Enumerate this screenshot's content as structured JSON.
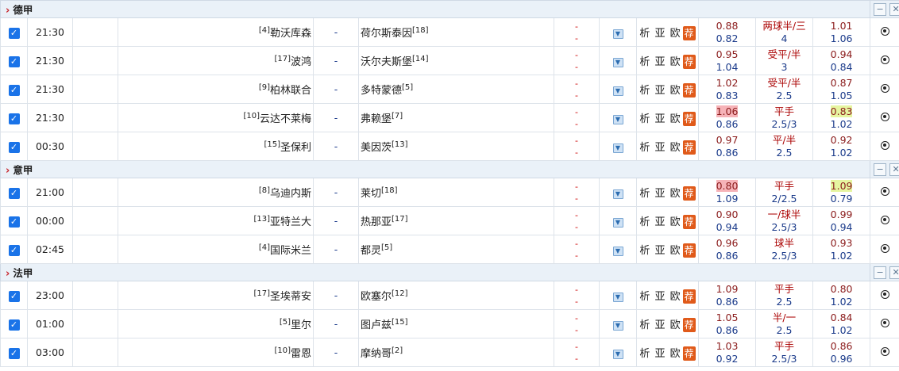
{
  "leagues": [
    {
      "name": "德甲",
      "matches": [
        {
          "time": "21:30",
          "home_rank": "[4]",
          "home": "勒沃库森",
          "vs": "-",
          "away": "荷尔斯泰因",
          "away_rank": "[18]",
          "score_top": "-",
          "score_bot": "-",
          "links": "析 亚 欧",
          "tip": "荐",
          "o1a": "0.88",
          "o1b": "0.82",
          "h1": "两球半/三",
          "h2": "4",
          "o2a": "1.01",
          "o2b": "1.06",
          "hl1": "",
          "hl2": ""
        },
        {
          "time": "21:30",
          "home_rank": "[17]",
          "home": "波鸿",
          "vs": "-",
          "away": "沃尔夫斯堡",
          "away_rank": "[14]",
          "score_top": "-",
          "score_bot": "-",
          "links": "析 亚 欧",
          "tip": "荐",
          "o1a": "0.95",
          "o1b": "1.04",
          "h1": "受平/半",
          "h2": "3",
          "o2a": "0.94",
          "o2b": "0.84",
          "hl1": "",
          "hl2": ""
        },
        {
          "time": "21:30",
          "home_rank": "[9]",
          "home": "柏林联合",
          "vs": "-",
          "away": "多特蒙德",
          "away_rank": "[5]",
          "score_top": "-",
          "score_bot": "-",
          "links": "析 亚 欧",
          "tip": "荐",
          "o1a": "1.02",
          "o1b": "0.83",
          "h1": "受平/半",
          "h2": "2.5",
          "o2a": "0.87",
          "o2b": "1.05",
          "hl1": "",
          "hl2": ""
        },
        {
          "time": "21:30",
          "home_rank": "[10]",
          "home": "云达不莱梅",
          "vs": "-",
          "away": "弗赖堡",
          "away_rank": "[7]",
          "score_top": "-",
          "score_bot": "-",
          "links": "析 亚 欧",
          "tip": "荐",
          "o1a": "1.06",
          "o1b": "0.86",
          "h1": "平手",
          "h2": "2.5/3",
          "o2a": "0.83",
          "o2b": "1.02",
          "hl1": "pk",
          "hl2": "yl"
        },
        {
          "time": "00:30",
          "home_rank": "[15]",
          "home": "圣保利",
          "vs": "-",
          "away": "美因茨",
          "away_rank": "[13]",
          "score_top": "-",
          "score_bot": "-",
          "links": "析 亚 欧",
          "tip": "荐",
          "o1a": "0.97",
          "o1b": "0.86",
          "h1": "平/半",
          "h2": "2.5",
          "o2a": "0.92",
          "o2b": "1.02",
          "hl1": "",
          "hl2": ""
        }
      ]
    },
    {
      "name": "意甲",
      "matches": [
        {
          "time": "21:00",
          "home_rank": "[8]",
          "home": "乌迪内斯",
          "vs": "-",
          "away": "莱切",
          "away_rank": "[18]",
          "score_top": "-",
          "score_bot": "-",
          "links": "析 亚 欧",
          "tip": "荐",
          "o1a": "0.80",
          "o1b": "1.09",
          "h1": "平手",
          "h2": "2/2.5",
          "o2a": "1.09",
          "o2b": "0.79",
          "hl1": "pk",
          "hl2": "yl"
        },
        {
          "time": "00:00",
          "home_rank": "[13]",
          "home": "亚特兰大",
          "vs": "-",
          "away": "热那亚",
          "away_rank": "[17]",
          "score_top": "-",
          "score_bot": "-",
          "links": "析 亚 欧",
          "tip": "荐",
          "o1a": "0.90",
          "o1b": "0.94",
          "h1": "一/球半",
          "h2": "2.5/3",
          "o2a": "0.99",
          "o2b": "0.94",
          "hl1": "",
          "hl2": ""
        },
        {
          "time": "02:45",
          "home_rank": "[4]",
          "home": "国际米兰",
          "vs": "-",
          "away": "都灵",
          "away_rank": "[5]",
          "score_top": "-",
          "score_bot": "-",
          "links": "析 亚 欧",
          "tip": "荐",
          "o1a": "0.96",
          "o1b": "0.86",
          "h1": "球半",
          "h2": "2.5/3",
          "o2a": "0.93",
          "o2b": "1.02",
          "hl1": "",
          "hl2": ""
        }
      ]
    },
    {
      "name": "法甲",
      "matches": [
        {
          "time": "23:00",
          "home_rank": "[17]",
          "home": "圣埃蒂安",
          "vs": "-",
          "away": "欧塞尔",
          "away_rank": "[12]",
          "score_top": "-",
          "score_bot": "-",
          "links": "析 亚 欧",
          "tip": "荐",
          "o1a": "1.09",
          "o1b": "0.86",
          "h1": "平手",
          "h2": "2.5",
          "o2a": "0.80",
          "o2b": "1.02",
          "hl1": "",
          "hl2": ""
        },
        {
          "time": "01:00",
          "home_rank": "[5]",
          "home": "里尔",
          "vs": "-",
          "away": "图卢兹",
          "away_rank": "[15]",
          "score_top": "-",
          "score_bot": "-",
          "links": "析 亚 欧",
          "tip": "荐",
          "o1a": "1.05",
          "o1b": "0.86",
          "h1": "半/一",
          "h2": "2.5",
          "o2a": "0.84",
          "o2b": "1.02",
          "hl1": "",
          "hl2": ""
        },
        {
          "time": "03:00",
          "home_rank": "[10]",
          "home": "雷恩",
          "vs": "-",
          "away": "摩纳哥",
          "away_rank": "[2]",
          "score_top": "-",
          "score_bot": "-",
          "links": "析 亚 欧",
          "tip": "荐",
          "o1a": "1.03",
          "o1b": "0.92",
          "h1": "平手",
          "h2": "2.5/3",
          "o2a": "0.86",
          "o2b": "0.96",
          "hl1": "",
          "hl2": ""
        }
      ]
    }
  ],
  "icons": {
    "checkbox": "checkbox-icon",
    "collapse": "minus-icon",
    "close": "close-icon",
    "dropdown": "chevron-down-icon",
    "ball": "football-icon",
    "arrow": "chevron-right-icon"
  },
  "colors": {
    "checkbox": "#1a73e8",
    "tip": "#e05a1a",
    "odds_up": "#8b1c1c",
    "odds_down": "#1a3a8a",
    "hl_pink": "#f6b3b8",
    "hl_yellow": "#e6f5a0",
    "league_bg": "#eaf1f8"
  }
}
